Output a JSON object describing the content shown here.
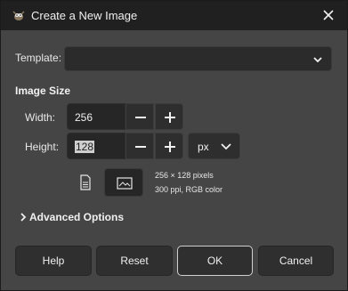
{
  "dialog": {
    "title": "Create a New Image"
  },
  "template": {
    "label": "Template:",
    "value": ""
  },
  "image_size": {
    "heading": "Image Size",
    "width_label": "Width:",
    "width_value": "256",
    "height_label": "Height:",
    "height_value": "128",
    "unit": "px",
    "info_line1": "256 × 128 pixels",
    "info_line2": "300 ppi, RGB color"
  },
  "advanced": {
    "label": "Advanced Options"
  },
  "buttons": {
    "help": "Help",
    "reset": "Reset",
    "ok": "OK",
    "cancel": "Cancel"
  },
  "icons": {
    "app": "gimp-wilber-icon",
    "close": "close-icon",
    "portrait": "portrait-orientation-icon",
    "landscape": "landscape-orientation-icon"
  }
}
